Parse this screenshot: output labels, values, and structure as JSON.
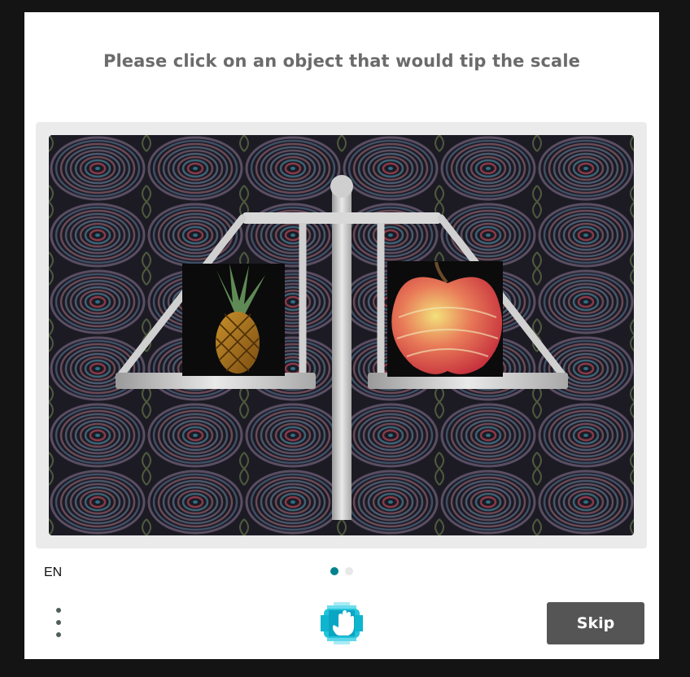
{
  "prompt": "Please click on an object that would tip the scale",
  "challenge_image": {
    "objects": [
      "pineapple",
      "apple",
      "balance-scale"
    ]
  },
  "footer": {
    "language": "EN",
    "pagination": {
      "total": 2,
      "active": 0
    },
    "skip_label": "Skip",
    "menu_icon": "vertical-dots-icon",
    "logo_icon": "hand-logo-icon"
  },
  "colors": {
    "background": "#141414",
    "card": "#ffffff",
    "prompt_text": "#6b6b6b",
    "frame": "#ebebeb",
    "dot_active": "#00838f",
    "dot_inactive": "#e8e8e8",
    "skip_button": "#555555",
    "accent": "#00bcd4"
  }
}
